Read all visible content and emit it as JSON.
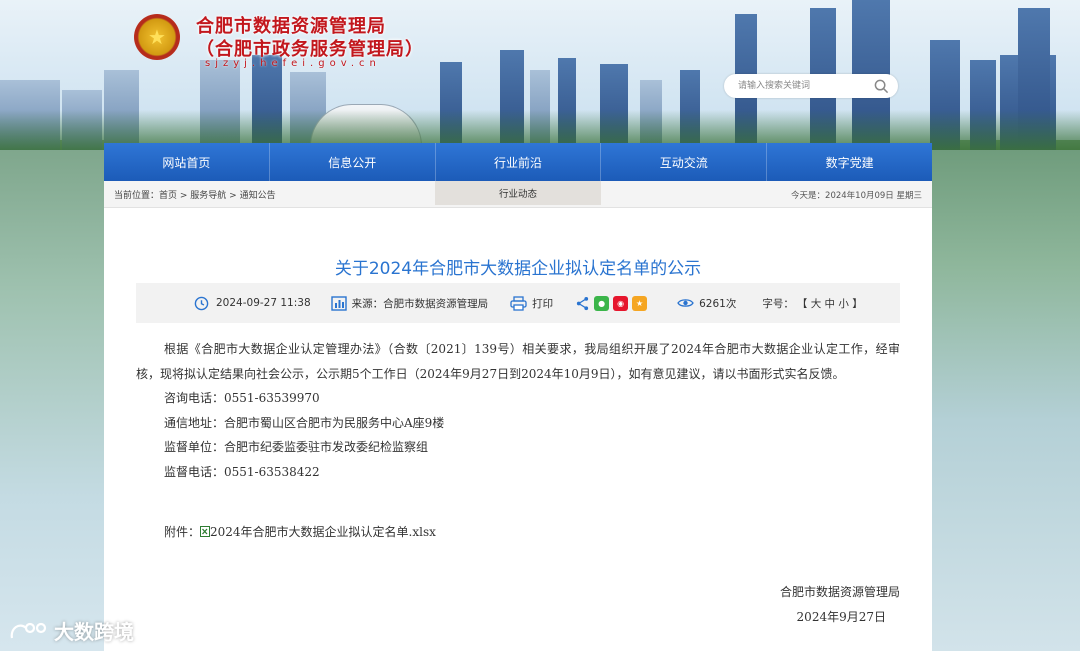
{
  "header": {
    "site_name_line1": "合肥市数据资源管理局",
    "site_name_line2": "（合肥市政务服务管理局）",
    "domain": "sjzyj.hefei.gov.cn",
    "search_placeholder": "请输入搜索关键词"
  },
  "nav": {
    "items": [
      {
        "label": "网站首页"
      },
      {
        "label": "信息公开"
      },
      {
        "label": "行业前沿"
      },
      {
        "label": "互动交流"
      },
      {
        "label": "数字党建"
      }
    ],
    "subtab": "行业动态"
  },
  "breadcrumb": {
    "prefix": "当前位置：",
    "items": [
      "首页",
      "服务导航",
      "通知公告"
    ],
    "separator": " > "
  },
  "today": "今天是：2024年10月09日 星期三",
  "article": {
    "title": "关于2024年合肥市大数据企业拟认定名单的公示",
    "date": "2024-09-27 11:38",
    "source": "来源：合肥市数据资源管理局",
    "print_label": "打印",
    "views": "6261次",
    "font_size_label": "字号：",
    "font_size_options": "【 大 中 小 】",
    "paragraph": "根据《合肥市大数据企业认定管理办法》（合数〔2021〕139号）相关要求，我局组织开展了2024年合肥市大数据企业认定工作，经审核，现将拟认定结果向社会公示，公示期5个工作日（2024年9月27日到2024年10月9日），如有意见建议，请以书面形式实名反馈。",
    "lines": [
      "咨询电话：0551-63539970",
      "通信地址：合肥市蜀山区合肥市为民服务中心A座9楼",
      "监督单位：合肥市纪委监委驻市发改委纪检监察组",
      "监督电话：0551-63538422"
    ],
    "attachment_label": "附件：",
    "attachment_name": "2024年合肥市大数据企业拟认定名单.xlsx",
    "signature_org": "合肥市数据资源管理局",
    "signature_date": "2024年9月27日"
  },
  "watermark": "大数跨境",
  "colors": {
    "nav_blue": "#1f5fbd",
    "title_blue": "#2a74d0",
    "brand_red": "#c2171d"
  }
}
